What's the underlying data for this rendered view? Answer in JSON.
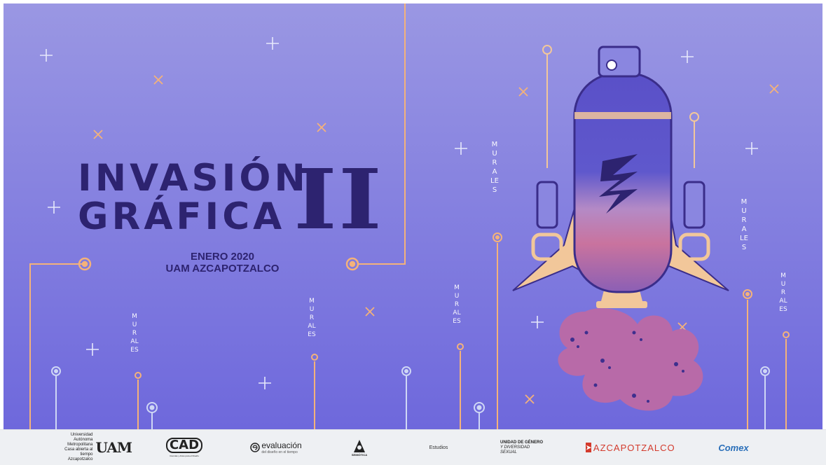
{
  "title": {
    "line1": "INVASIÓN",
    "line2": "GRÁFICA",
    "roman": "II",
    "date": "ENERO 2020",
    "place": "UAM AZCAPOTZALCO"
  },
  "vertical_label": "MURALES",
  "colors": {
    "background_top": "#9a97e3",
    "background_bottom": "#6e68dc",
    "title_ink": "#2d2370",
    "line_orange": "#f4b27a",
    "line_light": "#b9c7ee",
    "rocket_body": "#5a50c8",
    "rocket_frame": "#f2c79a",
    "exhaust": "#b86aa8"
  },
  "sponsors": {
    "uam_lines": [
      "Universidad",
      "Autónoma",
      "Metropolitana",
      "Casa abierta al tiempo  Azcapotzalco"
    ],
    "uam_mark": "UAM",
    "cad": "CAD",
    "cad_sub": "Ciencias y Artes para el Diseño",
    "evaluacion": "evaluación",
    "evaluacion_sub": "del diseño en el tiempo",
    "semiotica": "SEMIÓTICA",
    "estudios": "Estudios",
    "genero_line1": "UNIDAD DE GÉNERO",
    "genero_line2": "Y DIVERSIDAD SEXUAL",
    "azcapotzalco": "AZCAPOTZALCO",
    "comex": "Comex"
  }
}
